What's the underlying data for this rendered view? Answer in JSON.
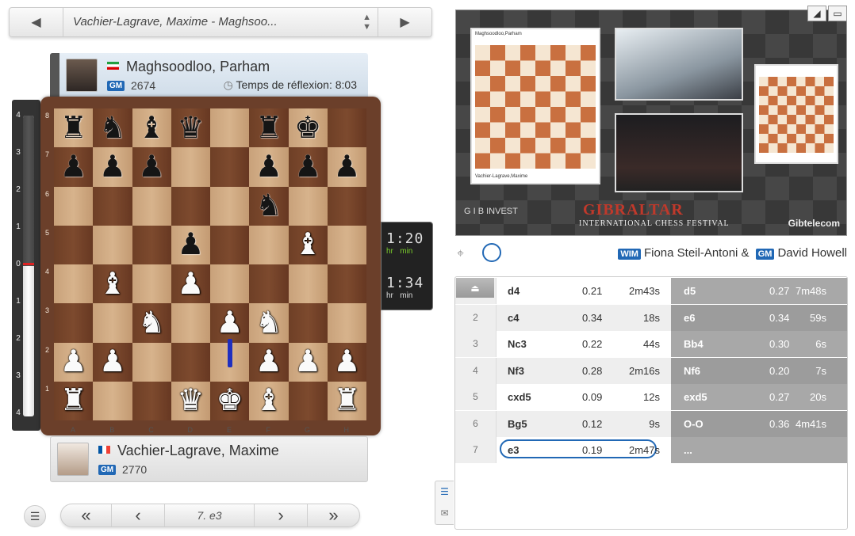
{
  "game_selector": {
    "title": "Vachier-Lagrave, Maxime - Maghsoo...",
    "prev_icon": "◀",
    "next_icon": "▶"
  },
  "top_player": {
    "name": "Maghsoodloo, Parham",
    "title": "GM",
    "rating": "2674",
    "think_label": "Temps de réflexion: 8:03",
    "flag": "Iran"
  },
  "bottom_player": {
    "name": "Vachier-Lagrave, Maxime",
    "title": "GM",
    "rating": "2770",
    "flag": "France"
  },
  "eval_ticks": [
    "4",
    "3",
    "2",
    "1",
    "0",
    "1",
    "2",
    "3",
    "4"
  ],
  "board": {
    "ranks": [
      "8",
      "7",
      "6",
      "5",
      "4",
      "3",
      "2",
      "1"
    ],
    "files": [
      "A",
      "B",
      "C",
      "D",
      "E",
      "F",
      "G",
      "H"
    ],
    "position": [
      [
        "br",
        "bn",
        "bb",
        "bq",
        "",
        "br",
        "bk",
        ""
      ],
      [
        "bp",
        "bp",
        "bp",
        "",
        "",
        "bp",
        "bp",
        "bp"
      ],
      [
        "",
        "",
        "",
        "",
        "",
        "bn",
        "",
        ""
      ],
      [
        "",
        "",
        "",
        "bp",
        "",
        "",
        "wb",
        ""
      ],
      [
        "",
        "wb",
        "",
        "wp",
        "",
        "",
        "",
        ""
      ],
      [
        "",
        "",
        "wn",
        "",
        "wp",
        "wn",
        "",
        ""
      ],
      [
        "wp",
        "wp",
        "",
        "",
        "",
        "wp",
        "wp",
        "wp"
      ],
      [
        "wr",
        "",
        "",
        "wq",
        "wk",
        "wb",
        "",
        "wr"
      ]
    ]
  },
  "clocks": {
    "top": {
      "time": "1:20",
      "hr": "hr",
      "min": "min"
    },
    "bottom": {
      "time": "1:34",
      "hr": "hr",
      "min": "min"
    }
  },
  "video": {
    "brand": "GIBRALTAR",
    "brand_sub": "INTERNATIONAL CHESS FESTIVAL",
    "sponsor_left": "G I B INVEST",
    "sponsor_right": "Gibtelecom",
    "overlay_top": "Maghsoodloo,Parham",
    "overlay_bottom": "Vachier-Lagrave,Maxime"
  },
  "commentators": {
    "c1_title": "WIM",
    "c1": "Fiona Steil-Antoni &",
    "c2_title": "GM",
    "c2": "David Howell"
  },
  "moves": [
    {
      "n": "1",
      "w": "d4",
      "we": "0.21",
      "wt": "2m43s",
      "b": "d5",
      "be": "0.27",
      "bt": "7m48s"
    },
    {
      "n": "2",
      "w": "c4",
      "we": "0.34",
      "wt": "18s",
      "b": "e6",
      "be": "0.34",
      "bt": "59s"
    },
    {
      "n": "3",
      "w": "Nc3",
      "we": "0.22",
      "wt": "44s",
      "b": "Bb4",
      "be": "0.30",
      "bt": "6s"
    },
    {
      "n": "4",
      "w": "Nf3",
      "we": "0.28",
      "wt": "2m16s",
      "b": "Nf6",
      "be": "0.20",
      "bt": "7s"
    },
    {
      "n": "5",
      "w": "cxd5",
      "we": "0.09",
      "wt": "12s",
      "b": "exd5",
      "be": "0.27",
      "bt": "20s"
    },
    {
      "n": "6",
      "w": "Bg5",
      "we": "0.12",
      "wt": "9s",
      "b": "O-O",
      "be": "0.36",
      "bt": "4m41s"
    },
    {
      "n": "7",
      "w": "e3",
      "we": "0.19",
      "wt": "2m47s",
      "b": "...",
      "be": "",
      "bt": ""
    }
  ],
  "controls": {
    "first": "«",
    "prev": "‹",
    "current": "7. e3",
    "next": "›",
    "last": "»"
  },
  "colors": {
    "accent": "#2168b5",
    "move_arrow": "#1f2fbf",
    "clock_green": "#7acc2b"
  }
}
